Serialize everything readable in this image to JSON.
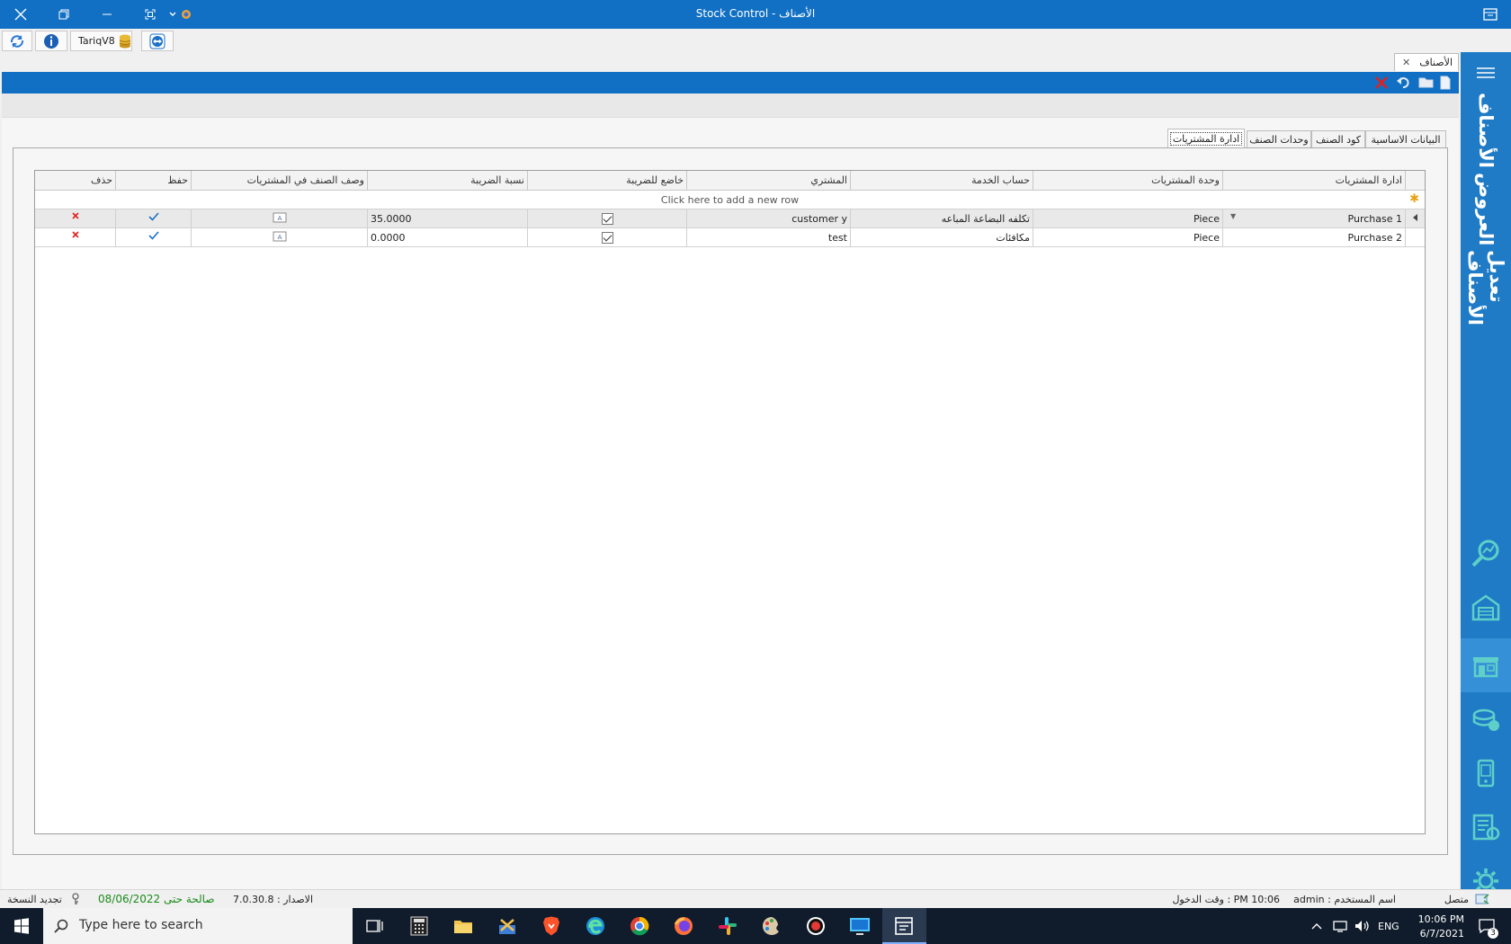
{
  "window": {
    "title": "Stock Control - الأصناف"
  },
  "quick_toolbar": {
    "db_label": "TariqV8"
  },
  "doc_tab": {
    "label": "الأصناف"
  },
  "tabs": [
    {
      "label": "البيانات الاساسية"
    },
    {
      "label": "كود الصنف"
    },
    {
      "label": "وحدات الصنف"
    },
    {
      "label": "ادارة المشتريات"
    }
  ],
  "grid": {
    "columns": [
      {
        "label": "ادارة المشتريات"
      },
      {
        "label": "وحدة المشتريات"
      },
      {
        "label": "حساب الخدمة"
      },
      {
        "label": "المشتري"
      },
      {
        "label": "خاضع للضريبة"
      },
      {
        "label": "نسبة الضريبة"
      },
      {
        "label": "وصف الصنف في المشتريات"
      },
      {
        "label": "حفظ"
      },
      {
        "label": "حذف"
      }
    ],
    "new_row_text": "Click here to add a new row",
    "rows": [
      {
        "name": "Purchase 1",
        "unit": "Piece",
        "service_account": "تكلفه البضاعة المباعه",
        "buyer": "customer y",
        "taxable": true,
        "tax_rate": "35.0000"
      },
      {
        "name": "Purchase 2",
        "unit": "Piece",
        "service_account": "مكافئات",
        "buyer": "test",
        "taxable": true,
        "tax_rate": "0.0000"
      }
    ]
  },
  "sidebar": {
    "items": [
      {
        "label": "الأصناف"
      },
      {
        "label": "العروض"
      },
      {
        "label": "تعديل الأصناف"
      }
    ]
  },
  "status": {
    "connection": "متصل",
    "username": "admin : اسم المستخدم",
    "login_time": "وقت الدخول : PM 10:06",
    "version": "الاصدار : 7.0.30.8",
    "valid_until": "صالحة حتى 08/06/2022",
    "renew": "تجديد النسخة"
  },
  "taskbar": {
    "search_placeholder": "Type here to search",
    "language": "ENG",
    "time": "10:06 PM",
    "date": "6/7/2021",
    "notification_count": "3"
  },
  "colors": {
    "title_bar": "#1170c3",
    "sidebar": "#1f7bc5",
    "taskbar": "#101c2c",
    "delete_red": "#e02020",
    "save_blue": "#1a6fc9",
    "valid_green": "#1a8a1a"
  }
}
